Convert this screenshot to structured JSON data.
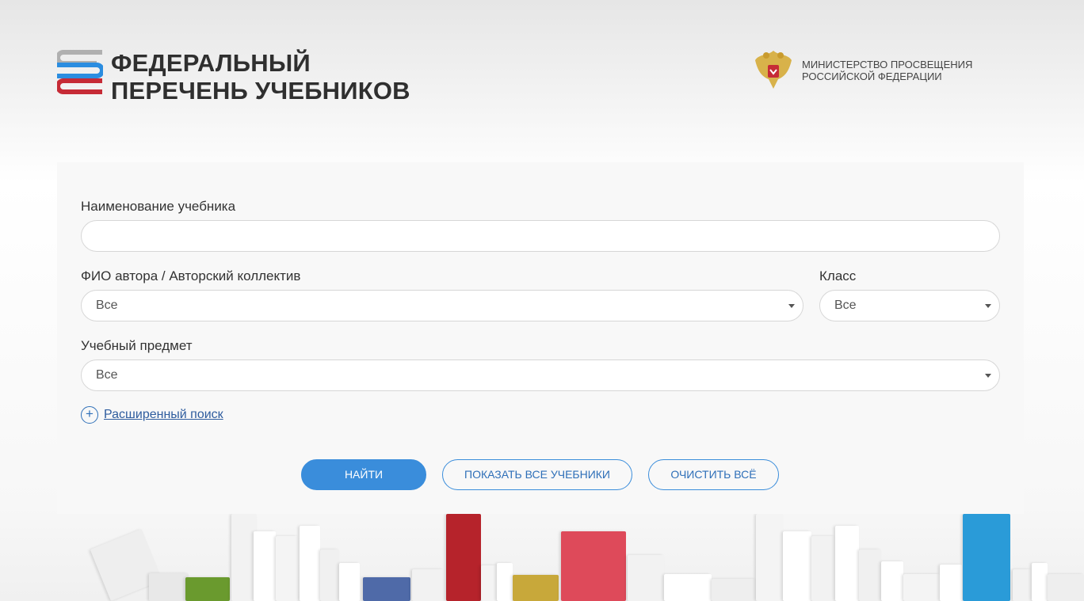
{
  "header": {
    "logo_line1": "ФЕДЕРАЛЬНЫЙ",
    "logo_line2": "ПЕРЕЧЕНЬ УЧЕБНИКОВ",
    "ministry_line1": "МИНИСТЕРСТВО ПРОСВЕЩЕНИЯ",
    "ministry_line2": "РОССИЙСКОЙ ФЕДЕРАЦИИ"
  },
  "form": {
    "title_label": "Наименование учебника",
    "title_value": "",
    "author_label": "ФИО автора / Авторский коллектив",
    "author_value": "Все",
    "grade_label": "Класс",
    "grade_value": "Все",
    "subject_label": "Учебный предмет",
    "subject_value": "Все",
    "advanced_search": "Расширенный поиск",
    "advanced_icon": "plus-circle-icon"
  },
  "buttons": {
    "find": "НАЙТИ",
    "show_all": "ПОКАЗАТЬ ВСЕ УЧЕБНИКИ",
    "clear_all": "ОЧИСТИТЬ ВСЁ"
  },
  "colors": {
    "primary": "#3a8ddb",
    "link": "#2e5c9e",
    "logo_gray": "#b0b0b0",
    "logo_blue": "#2b8de0",
    "logo_red": "#c62b36"
  }
}
